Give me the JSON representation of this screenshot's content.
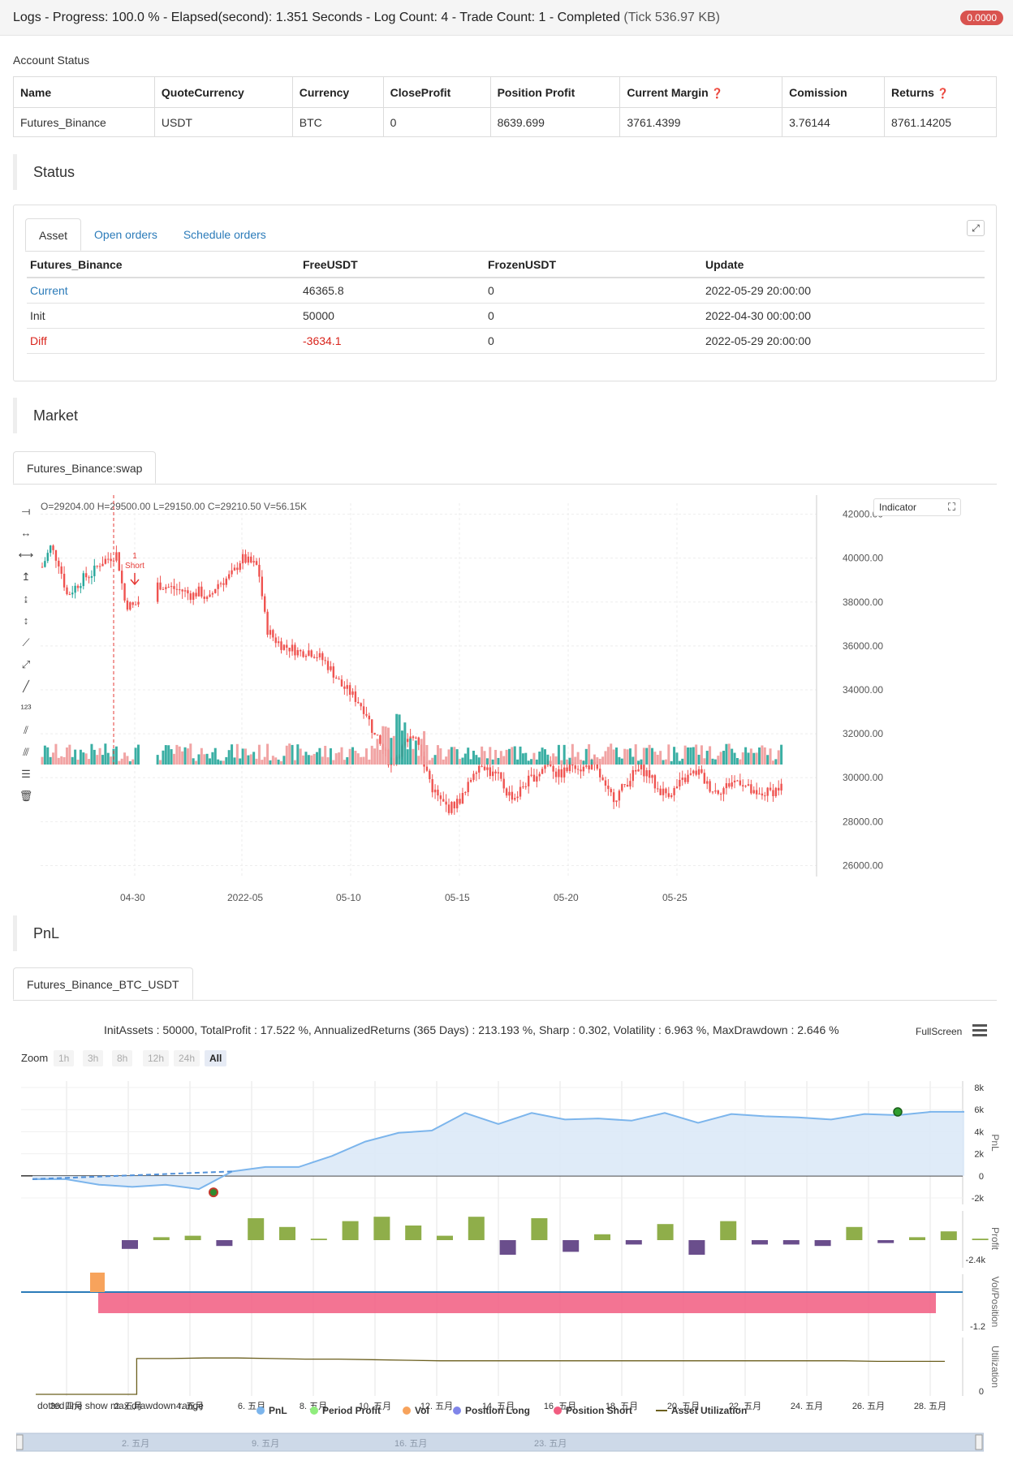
{
  "topbar": {
    "title": "Logs - Progress: 100.0 % - Elapsed(second): 1.351 Seconds - Log Count: 4 - Trade Count: 1 - Completed",
    "tick": "(Tick 536.97 KB)",
    "badge": "0.0000"
  },
  "account": {
    "label": "Account Status",
    "headers": [
      "Name",
      "QuoteCurrency",
      "Currency",
      "CloseProfit",
      "Position Profit",
      "Current Margin",
      "Comission",
      "Returns"
    ],
    "row": [
      "Futures_Binance",
      "USDT",
      "BTC",
      "0",
      "8639.699",
      "3761.4399",
      "3.76144",
      "8761.14205"
    ]
  },
  "status": {
    "heading": "Status",
    "tabs": [
      "Asset",
      "Open orders",
      "Schedule orders"
    ],
    "headers": [
      "Futures_Binance",
      "FreeUSDT",
      "FrozenUSDT",
      "Update"
    ],
    "rows": [
      [
        "Current",
        "46365.8",
        "0",
        "2022-05-29 20:00:00"
      ],
      [
        "Init",
        "50000",
        "0",
        "2022-04-30 00:00:00"
      ],
      [
        "Diff",
        "-3634.1",
        "0",
        "2022-05-29 20:00:00"
      ]
    ]
  },
  "market": {
    "heading": "Market",
    "tab": "Futures_Binance:swap",
    "ohlc": "O=29204.00 H=29500.00 L=29150.00 C=29210.50 V=56.15K",
    "indicator_label": "Indicator",
    "signal": {
      "count": "1",
      "label": "Short"
    },
    "colors": {
      "up": "#26a69a",
      "down": "#ef5350",
      "signal": "#e53935"
    }
  },
  "pnl": {
    "heading": "PnL",
    "tab": "Futures_Binance_BTC_USDT",
    "summary": "InitAssets : 50000, TotalProfit : 17.522 %, AnnualizedReturns (365 Days) : 213.193 %, Sharp : 0.302, Volatility : 6.963 %, MaxDrawdown : 2.646 %",
    "fullscreen": "FullScreen",
    "zoom_label": "Zoom",
    "zoom_options": [
      "1h",
      "3h",
      "8h",
      "12h",
      "24h",
      "All"
    ],
    "zoom_selected": "All",
    "panel_titles": [
      "PnL",
      "Profit",
      "Vol/Position",
      "Utilization"
    ],
    "note": "dotted line show max drawdown range",
    "legend": [
      "PnL",
      "Period Profit",
      "Vol",
      "Position Long",
      "Position Short",
      "Asset Utilization"
    ],
    "navigator_labels": [
      "2. 五月",
      "9. 五月",
      "16. 五月",
      "23. 五月"
    ],
    "colors": {
      "pnl": "#7cb5ec",
      "period_profit": "#90ed7d",
      "vol": "#f7a35c",
      "position_long": "#8085e9",
      "position_short": "#f15c80",
      "utilization": "#6b5f1e"
    }
  },
  "chart_data": [
    {
      "type": "candlestick",
      "title": "",
      "x_ticks": [
        "04-30",
        "2022-05",
        "05-10",
        "05-15",
        "05-20",
        "05-25"
      ],
      "y_ticks": [
        26000,
        28000,
        30000,
        32000,
        34000,
        36000,
        38000,
        40000,
        42000
      ],
      "ylim": [
        25500,
        42500
      ],
      "close_series": [
        39600,
        40500,
        39800,
        38300,
        38700,
        39100,
        39300,
        39800,
        40000,
        40200,
        37900,
        37800,
        38200,
        38600,
        38800,
        38700,
        38600,
        38500,
        38300,
        38500,
        38000,
        38800,
        39000,
        39300,
        40000,
        39800,
        39600,
        36800,
        36300,
        36000,
        35900,
        35700,
        35800,
        35600,
        35300,
        34800,
        34200,
        33900,
        33500,
        33000,
        31900,
        31300,
        30600,
        31200,
        31600,
        32000,
        30700,
        29500,
        28900,
        28600,
        28900,
        29300,
        30400,
        30700,
        30200,
        30000,
        29300,
        29100,
        29700,
        30000,
        30300,
        30800,
        30100,
        30300,
        30700,
        30400,
        30600,
        30200,
        29300,
        29100,
        29600,
        30100,
        30400,
        30200,
        29500,
        29300,
        29400,
        29800,
        30100,
        30300,
        29700,
        29400,
        29500,
        29800,
        29900,
        29500,
        29100,
        29300,
        29400,
        29600
      ],
      "grid": true
    },
    {
      "type": "area",
      "title": "",
      "series": [
        {
          "name": "PnL",
          "values": [
            -300,
            -300,
            -800,
            -1000,
            -800,
            -1200,
            400,
            800,
            800,
            1800,
            3100,
            3900,
            4100,
            5700,
            4700,
            5700,
            5100,
            5200,
            5000,
            5700,
            4800,
            5600,
            5400,
            5300,
            5100,
            5600,
            5500,
            5800,
            5800
          ]
        }
      ],
      "x_ticks": [
        "30. 四月",
        "2. 五月",
        "4. 五月",
        "6. 五月",
        "8. 五月",
        "10. 五月",
        "12. 五月",
        "14. 五月",
        "16. 五月",
        "18. 五月",
        "20. 五月",
        "22. 五月",
        "24. 五月",
        "26. 五月",
        "28. 五月"
      ],
      "y_ticks": [
        "8k",
        "6k",
        "4k",
        "2k",
        "0",
        "-2k"
      ],
      "ylim": [
        -2000,
        8000
      ]
    },
    {
      "type": "bar",
      "title": "",
      "series": [
        {
          "name": "Period Profit",
          "values": [
            -0.6,
            0.2,
            0.3,
            -0.4,
            1.5,
            0.9,
            0.1,
            1.3,
            1.6,
            1.0,
            0.3,
            1.6,
            -1.0,
            1.5,
            -0.8,
            0.4,
            -0.3,
            1.1,
            -1.0,
            1.3,
            -0.3,
            -0.3,
            -0.4,
            0.9,
            -0.2,
            0.2,
            0.6,
            0.1
          ]
        }
      ],
      "y_ticks": [
        "-2.4k"
      ]
    },
    {
      "type": "bar",
      "title": "",
      "series": [
        {
          "name": "Vol",
          "values": [
            1.0
          ]
        },
        {
          "name": "Position Short",
          "values": [
            -1.2
          ]
        }
      ],
      "y_ticks": [
        "-1.2"
      ]
    },
    {
      "type": "line",
      "title": "",
      "series": [
        {
          "name": "Asset Utilization",
          "values": [
            0,
            0,
            0,
            0.63,
            0.63,
            0.64,
            0.64,
            0.63,
            0.62,
            0.62,
            0.61,
            0.6,
            0.59,
            0.59,
            0.59,
            0.59,
            0.59,
            0.59,
            0.59,
            0.59,
            0.59,
            0.59,
            0.59,
            0.59,
            0.59,
            0.58,
            0.58,
            0.58
          ]
        }
      ],
      "y_ticks": [
        "0"
      ]
    }
  ]
}
